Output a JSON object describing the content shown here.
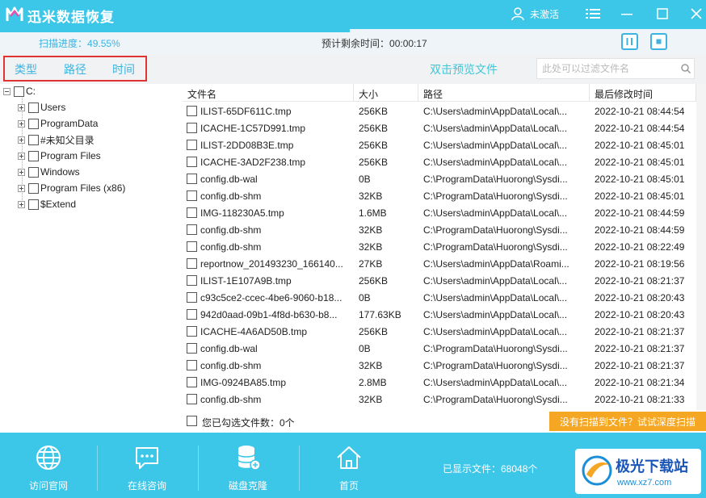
{
  "app": {
    "title": "迅米数据恢复",
    "user_status": "未激活"
  },
  "scan": {
    "progress_label": "扫描进度：",
    "progress_value": "49.55%",
    "progress_fraction": 0.4955,
    "remaining_label": "预计剩余时间：",
    "remaining_value": "00:00:17"
  },
  "filter": {
    "tabs": [
      "类型",
      "路径",
      "时间"
    ],
    "preview_label": "双击预览文件",
    "search_placeholder": "此处可以过滤文件名"
  },
  "tree": {
    "root": "C:",
    "children": [
      "Users",
      "ProgramData",
      "#未知父目录",
      "Program Files",
      "Windows",
      "Program Files (x86)",
      "$Extend"
    ]
  },
  "table": {
    "headers": [
      "文件名",
      "大小",
      "路径",
      "最后修改时间"
    ],
    "rows": [
      [
        "ILIST-65DF611C.tmp",
        "256KB",
        "C:\\Users\\admin\\AppData\\Local\\...",
        "2022-10-21 08:44:54"
      ],
      [
        "ICACHE-1C57D991.tmp",
        "256KB",
        "C:\\Users\\admin\\AppData\\Local\\...",
        "2022-10-21 08:44:54"
      ],
      [
        "ILIST-2DD08B3E.tmp",
        "256KB",
        "C:\\Users\\admin\\AppData\\Local\\...",
        "2022-10-21 08:45:01"
      ],
      [
        "ICACHE-3AD2F238.tmp",
        "256KB",
        "C:\\Users\\admin\\AppData\\Local\\...",
        "2022-10-21 08:45:01"
      ],
      [
        "config.db-wal",
        "0B",
        "C:\\ProgramData\\Huorong\\Sysdi...",
        "2022-10-21 08:45:01"
      ],
      [
        "config.db-shm",
        "32KB",
        "C:\\ProgramData\\Huorong\\Sysdi...",
        "2022-10-21 08:45:01"
      ],
      [
        "IMG-118230A5.tmp",
        "1.6MB",
        "C:\\Users\\admin\\AppData\\Local\\...",
        "2022-10-21 08:44:59"
      ],
      [
        "config.db-shm",
        "32KB",
        "C:\\ProgramData\\Huorong\\Sysdi...",
        "2022-10-21 08:44:59"
      ],
      [
        "config.db-shm",
        "32KB",
        "C:\\ProgramData\\Huorong\\Sysdi...",
        "2022-10-21 08:22:49"
      ],
      [
        "reportnow_201493230_166140...",
        "27KB",
        "C:\\Users\\admin\\AppData\\Roami...",
        "2022-10-21 08:19:56"
      ],
      [
        "ILIST-1E107A9B.tmp",
        "256KB",
        "C:\\Users\\admin\\AppData\\Local\\...",
        "2022-10-21 08:21:37"
      ],
      [
        "c93c5ce2-ccec-4be6-9060-b18...",
        "0B",
        "C:\\Users\\admin\\AppData\\Local\\...",
        "2022-10-21 08:20:43"
      ],
      [
        "942d0aad-09b1-4f8d-b630-b8...",
        "177.63KB",
        "C:\\Users\\admin\\AppData\\Local\\...",
        "2022-10-21 08:20:43"
      ],
      [
        "ICACHE-4A6AD50B.tmp",
        "256KB",
        "C:\\Users\\admin\\AppData\\Local\\...",
        "2022-10-21 08:21:37"
      ],
      [
        "config.db-wal",
        "0B",
        "C:\\ProgramData\\Huorong\\Sysdi...",
        "2022-10-21 08:21:37"
      ],
      [
        "config.db-shm",
        "32KB",
        "C:\\ProgramData\\Huorong\\Sysdi...",
        "2022-10-21 08:21:37"
      ],
      [
        "IMG-0924BA85.tmp",
        "2.8MB",
        "C:\\Users\\admin\\AppData\\Local\\...",
        "2022-10-21 08:21:34"
      ],
      [
        "config.db-shm",
        "32KB",
        "C:\\ProgramData\\Huorong\\Sysdi...",
        "2022-10-21 08:21:33"
      ]
    ]
  },
  "selection": {
    "label": "您已勾选文件数：0个"
  },
  "deep_scan": {
    "label": "没有扫描到文件？试试深度扫描"
  },
  "bottom_nav": [
    "访问官网",
    "在线咨询",
    "磁盘克隆",
    "首页"
  ],
  "shown_files": "已显示文件：68048个",
  "watermark": {
    "title": "极光下载站",
    "url": "www.xz7.com"
  },
  "colors": {
    "accent": "#3cc6e8",
    "highlight_border": "#e03333",
    "deep_scan_bg": "#f5a623"
  }
}
